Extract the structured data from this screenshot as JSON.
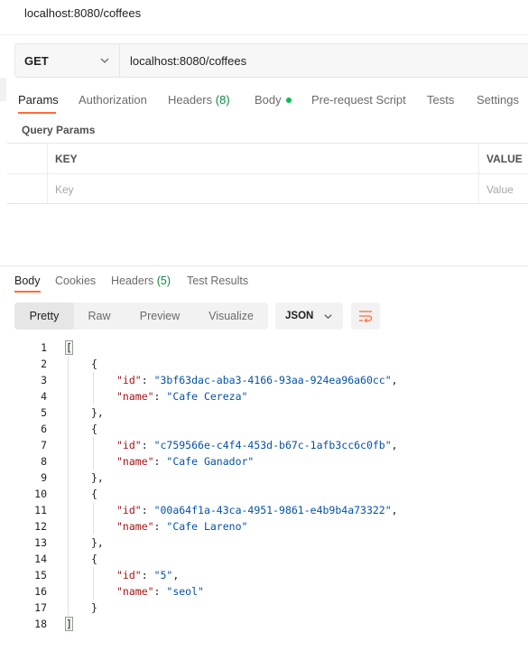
{
  "window": {
    "title": "localhost:8080/coffees"
  },
  "request": {
    "method": "GET",
    "url": "localhost:8080/coffees"
  },
  "request_tabs": [
    {
      "label": "Params",
      "active": true
    },
    {
      "label": "Authorization"
    },
    {
      "label": "Headers",
      "count": "(8)"
    },
    {
      "label": "Body",
      "indicator": "green-dot-icon"
    },
    {
      "label": "Pre-request Script"
    },
    {
      "label": "Tests"
    },
    {
      "label": "Settings"
    }
  ],
  "query_params": {
    "section_label": "Query Params",
    "columns": [
      "KEY",
      "VALUE"
    ],
    "placeholders": {
      "key": "Key",
      "value": "Value"
    }
  },
  "response_tabs": [
    {
      "label": "Body",
      "active": true
    },
    {
      "label": "Cookies"
    },
    {
      "label": "Headers",
      "count": "(5)"
    },
    {
      "label": "Test Results"
    }
  ],
  "view_modes": [
    "Pretty",
    "Raw",
    "Preview",
    "Visualize"
  ],
  "active_view": "Pretty",
  "format": "JSON",
  "icons": {
    "method_dropdown": "chevron-down-icon",
    "format_dropdown": "chevron-down-icon",
    "wrap": "wrap-lines-icon"
  },
  "colors": {
    "accent": "#ff6c37",
    "count_green": "#0f8a3c",
    "json_key": "#a31515",
    "json_string": "#0451a5"
  },
  "response_body": {
    "line_numbers": [
      "1",
      "2",
      "3",
      "4",
      "5",
      "6",
      "7",
      "8",
      "9",
      "10",
      "11",
      "12",
      "13",
      "14",
      "15",
      "16",
      "17",
      "18"
    ],
    "items": [
      {
        "id": "3bf63dac-aba3-4166-93aa-924ea96a60cc",
        "name": "Cafe Cereza"
      },
      {
        "id": "c759566e-c4f4-453d-b67c-1afb3cc6c0fb",
        "name": "Cafe Ganador"
      },
      {
        "id": "00a64f1a-43ca-4951-9861-e4b9b4a73322",
        "name": "Cafe Lareno"
      },
      {
        "id": "5",
        "name": "seol"
      }
    ]
  }
}
